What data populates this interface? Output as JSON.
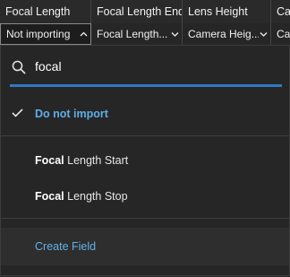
{
  "columns": {
    "headers": [
      "Focal Length",
      "Focal Length End",
      "Lens Height",
      "Ca"
    ],
    "selects": [
      "Not importing",
      "Focal Length...",
      "Camera Heig...",
      "Car"
    ]
  },
  "search": {
    "value": "focal",
    "placeholder": ""
  },
  "options": {
    "do_not_import": "Do not import",
    "items": [
      {
        "match": "Focal",
        "rest": " Length Start"
      },
      {
        "match": "Focal",
        "rest": " Length Stop"
      }
    ],
    "create_field": "Create Field"
  },
  "colors": {
    "accent": "#2f78c4",
    "selected_text": "#5eaee8",
    "link_text": "#62b1ea"
  },
  "icons": {
    "search": "search-icon",
    "check": "check-icon",
    "chevron_up": "chevron-up-icon",
    "chevron_down": "chevron-down-icon"
  }
}
